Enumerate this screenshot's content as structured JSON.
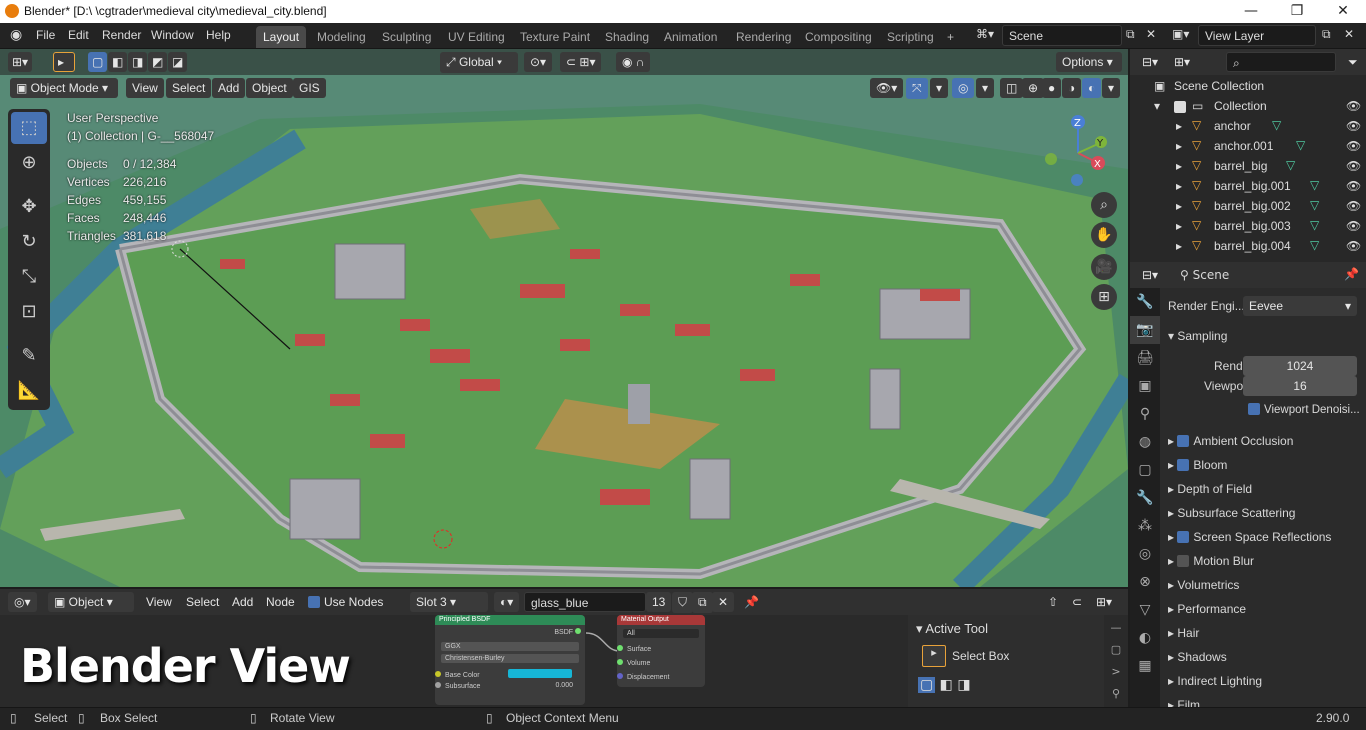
{
  "window": {
    "title": "Blender* [D:\\     \\cgtrader\\medieval city\\medieval_city.blend]",
    "minimize": "—",
    "maximize": "❐",
    "close": "✕"
  },
  "menus": [
    "File",
    "Edit",
    "Render",
    "Window",
    "Help"
  ],
  "workspace_tabs": [
    {
      "label": "Layout",
      "active": true
    },
    {
      "label": "Modeling"
    },
    {
      "label": "Sculpting"
    },
    {
      "label": "UV Editing"
    },
    {
      "label": "Texture Paint"
    },
    {
      "label": "Shading"
    },
    {
      "label": "Animation"
    },
    {
      "label": "Rendering"
    },
    {
      "label": "Compositing"
    },
    {
      "label": "Scripting"
    }
  ],
  "scene_field": "Scene",
  "view_layer_field": "View Layer",
  "viewport": {
    "transform_orientation": "Global",
    "options_label": "Options",
    "mode": "Object Mode",
    "menus": [
      "View",
      "Select",
      "Add",
      "Object",
      "GIS"
    ],
    "perspective": "User Perspective",
    "collection": "(1) Collection | G-__568047",
    "stats": [
      {
        "label": "Objects",
        "value": "0 / 12,384"
      },
      {
        "label": "Vertices",
        "value": "226,216"
      },
      {
        "label": "Edges",
        "value": "459,155"
      },
      {
        "label": "Faces",
        "value": "248,446"
      },
      {
        "label": "Triangles",
        "value": "381,618"
      }
    ],
    "gizmo": {
      "z": "Z",
      "y": "Y",
      "x": "X"
    }
  },
  "node_editor": {
    "type": "Object",
    "menus": [
      "View",
      "Select",
      "Add",
      "Node"
    ],
    "use_nodes": "Use Nodes",
    "slot": "Slot 3",
    "material": "glass_blue",
    "users": "13",
    "principled": {
      "title": "Principled BSDF",
      "out": "BSDF",
      "dist": "GGX",
      "sss": "Christensen-Burley",
      "base_color": "Base Color",
      "subsurface": "Subsurface",
      "subsurface_val": "0.000"
    },
    "output": {
      "title": "Material Output",
      "target": "All",
      "surface": "Surface",
      "volume": "Volume",
      "displacement": "Displacement"
    },
    "active_tool": {
      "title": "Active Tool",
      "tool": "Select Box"
    }
  },
  "overlay_caption": "Blender View",
  "outliner": {
    "root": "Scene Collection",
    "collection": "Collection",
    "items": [
      "anchor",
      "anchor.001",
      "barrel_big",
      "barrel_big.001",
      "barrel_big.002",
      "barrel_big.003",
      "barrel_big.004"
    ]
  },
  "properties": {
    "context": "Scene",
    "render_engine_label": "Render Engi...",
    "render_engine": "Eevee",
    "sampling": "Sampling",
    "render_label": "Render",
    "render_value": "1024",
    "viewport_label": "Viewport",
    "viewport_value": "16",
    "viewport_denoise": "Viewport Denoisi...",
    "sections": [
      {
        "label": "Ambient Occlusion",
        "check": "on"
      },
      {
        "label": "Bloom",
        "check": "on"
      },
      {
        "label": "Depth of Field",
        "check": "none"
      },
      {
        "label": "Subsurface Scattering",
        "check": "none"
      },
      {
        "label": "Screen Space Reflections",
        "check": "on"
      },
      {
        "label": "Motion Blur",
        "check": "off"
      },
      {
        "label": "Volumetrics",
        "check": "none"
      },
      {
        "label": "Performance",
        "check": "none"
      },
      {
        "label": "Hair",
        "check": "none"
      },
      {
        "label": "Shadows",
        "check": "none"
      },
      {
        "label": "Indirect Lighting",
        "check": "none"
      },
      {
        "label": "Film",
        "check": "none"
      }
    ]
  },
  "statusbar": {
    "select": "Select",
    "box_select": "Box Select",
    "rotate": "Rotate View",
    "context_menu": "Object Context Menu",
    "version": "2.90.0"
  }
}
